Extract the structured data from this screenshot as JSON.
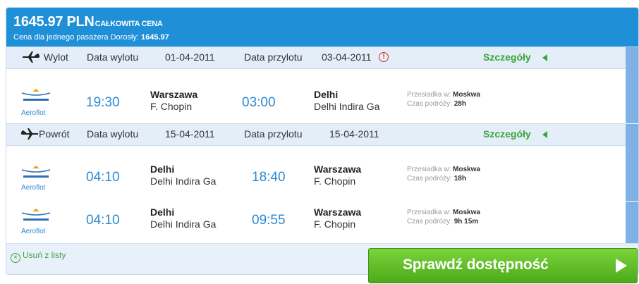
{
  "header": {
    "price": "1645.97 PLN",
    "total_label": "CAŁKOWITA CENA",
    "per_passenger_label": "Cena dla jednego pasażera Dorosły:",
    "per_passenger_price": "1645.97"
  },
  "outbound": {
    "label": "Wylot",
    "departure_date_label": "Data wylotu",
    "departure_date": "01-04-2011",
    "arrival_date_label": "Data przylotu",
    "arrival_date": "03-04-2011",
    "warning_icon": "exclamation-circle",
    "details_label": "Szczegóły",
    "flights": [
      {
        "airline": "Aeroflot",
        "dep_time": "19:30",
        "dep_city": "Warszawa",
        "dep_airport": "F. Chopin",
        "arr_time": "03:00",
        "arr_city": "Delhi",
        "arr_airport": "Delhi Indira Ga",
        "transfer_label": "Przesiadka w:",
        "transfer_city": "Moskwa",
        "duration_label": "Czas podróży:",
        "duration": "28h"
      }
    ]
  },
  "return": {
    "label": "Powrót",
    "departure_date_label": "Data wylotu",
    "departure_date": "15-04-2011",
    "arrival_date_label": "Data przylotu",
    "arrival_date": "15-04-2011",
    "details_label": "Szczegóły",
    "flights": [
      {
        "airline": "Aeroflot",
        "dep_time": "04:10",
        "dep_city": "Delhi",
        "dep_airport": "Delhi Indira Ga",
        "arr_time": "18:40",
        "arr_city": "Warszawa",
        "arr_airport": "F. Chopin",
        "transfer_label": "Przesiadka w:",
        "transfer_city": "Moskwa",
        "duration_label": "Czas podróży:",
        "duration": "18h"
      },
      {
        "airline": "Aeroflot",
        "dep_time": "04:10",
        "dep_city": "Delhi",
        "dep_airport": "Delhi Indira Ga",
        "arr_time": "09:55",
        "arr_city": "Warszawa",
        "arr_airport": "F. Chopin",
        "transfer_label": "Przesiadka w:",
        "transfer_city": "Moskwa",
        "duration_label": "Czas podróży:",
        "duration": "9h 15m"
      }
    ]
  },
  "actions": {
    "remove_label": "Usuń z listy",
    "check_availability_label": "Sprawdź dostępność"
  },
  "colors": {
    "header_bg": "#1f8fd8",
    "section_bg": "#e4eef8",
    "time_blue": "#2d8ad2",
    "accent_green": "#3aa53a",
    "warning_red": "#e02b1b",
    "cta_green": "#5cbf26"
  }
}
